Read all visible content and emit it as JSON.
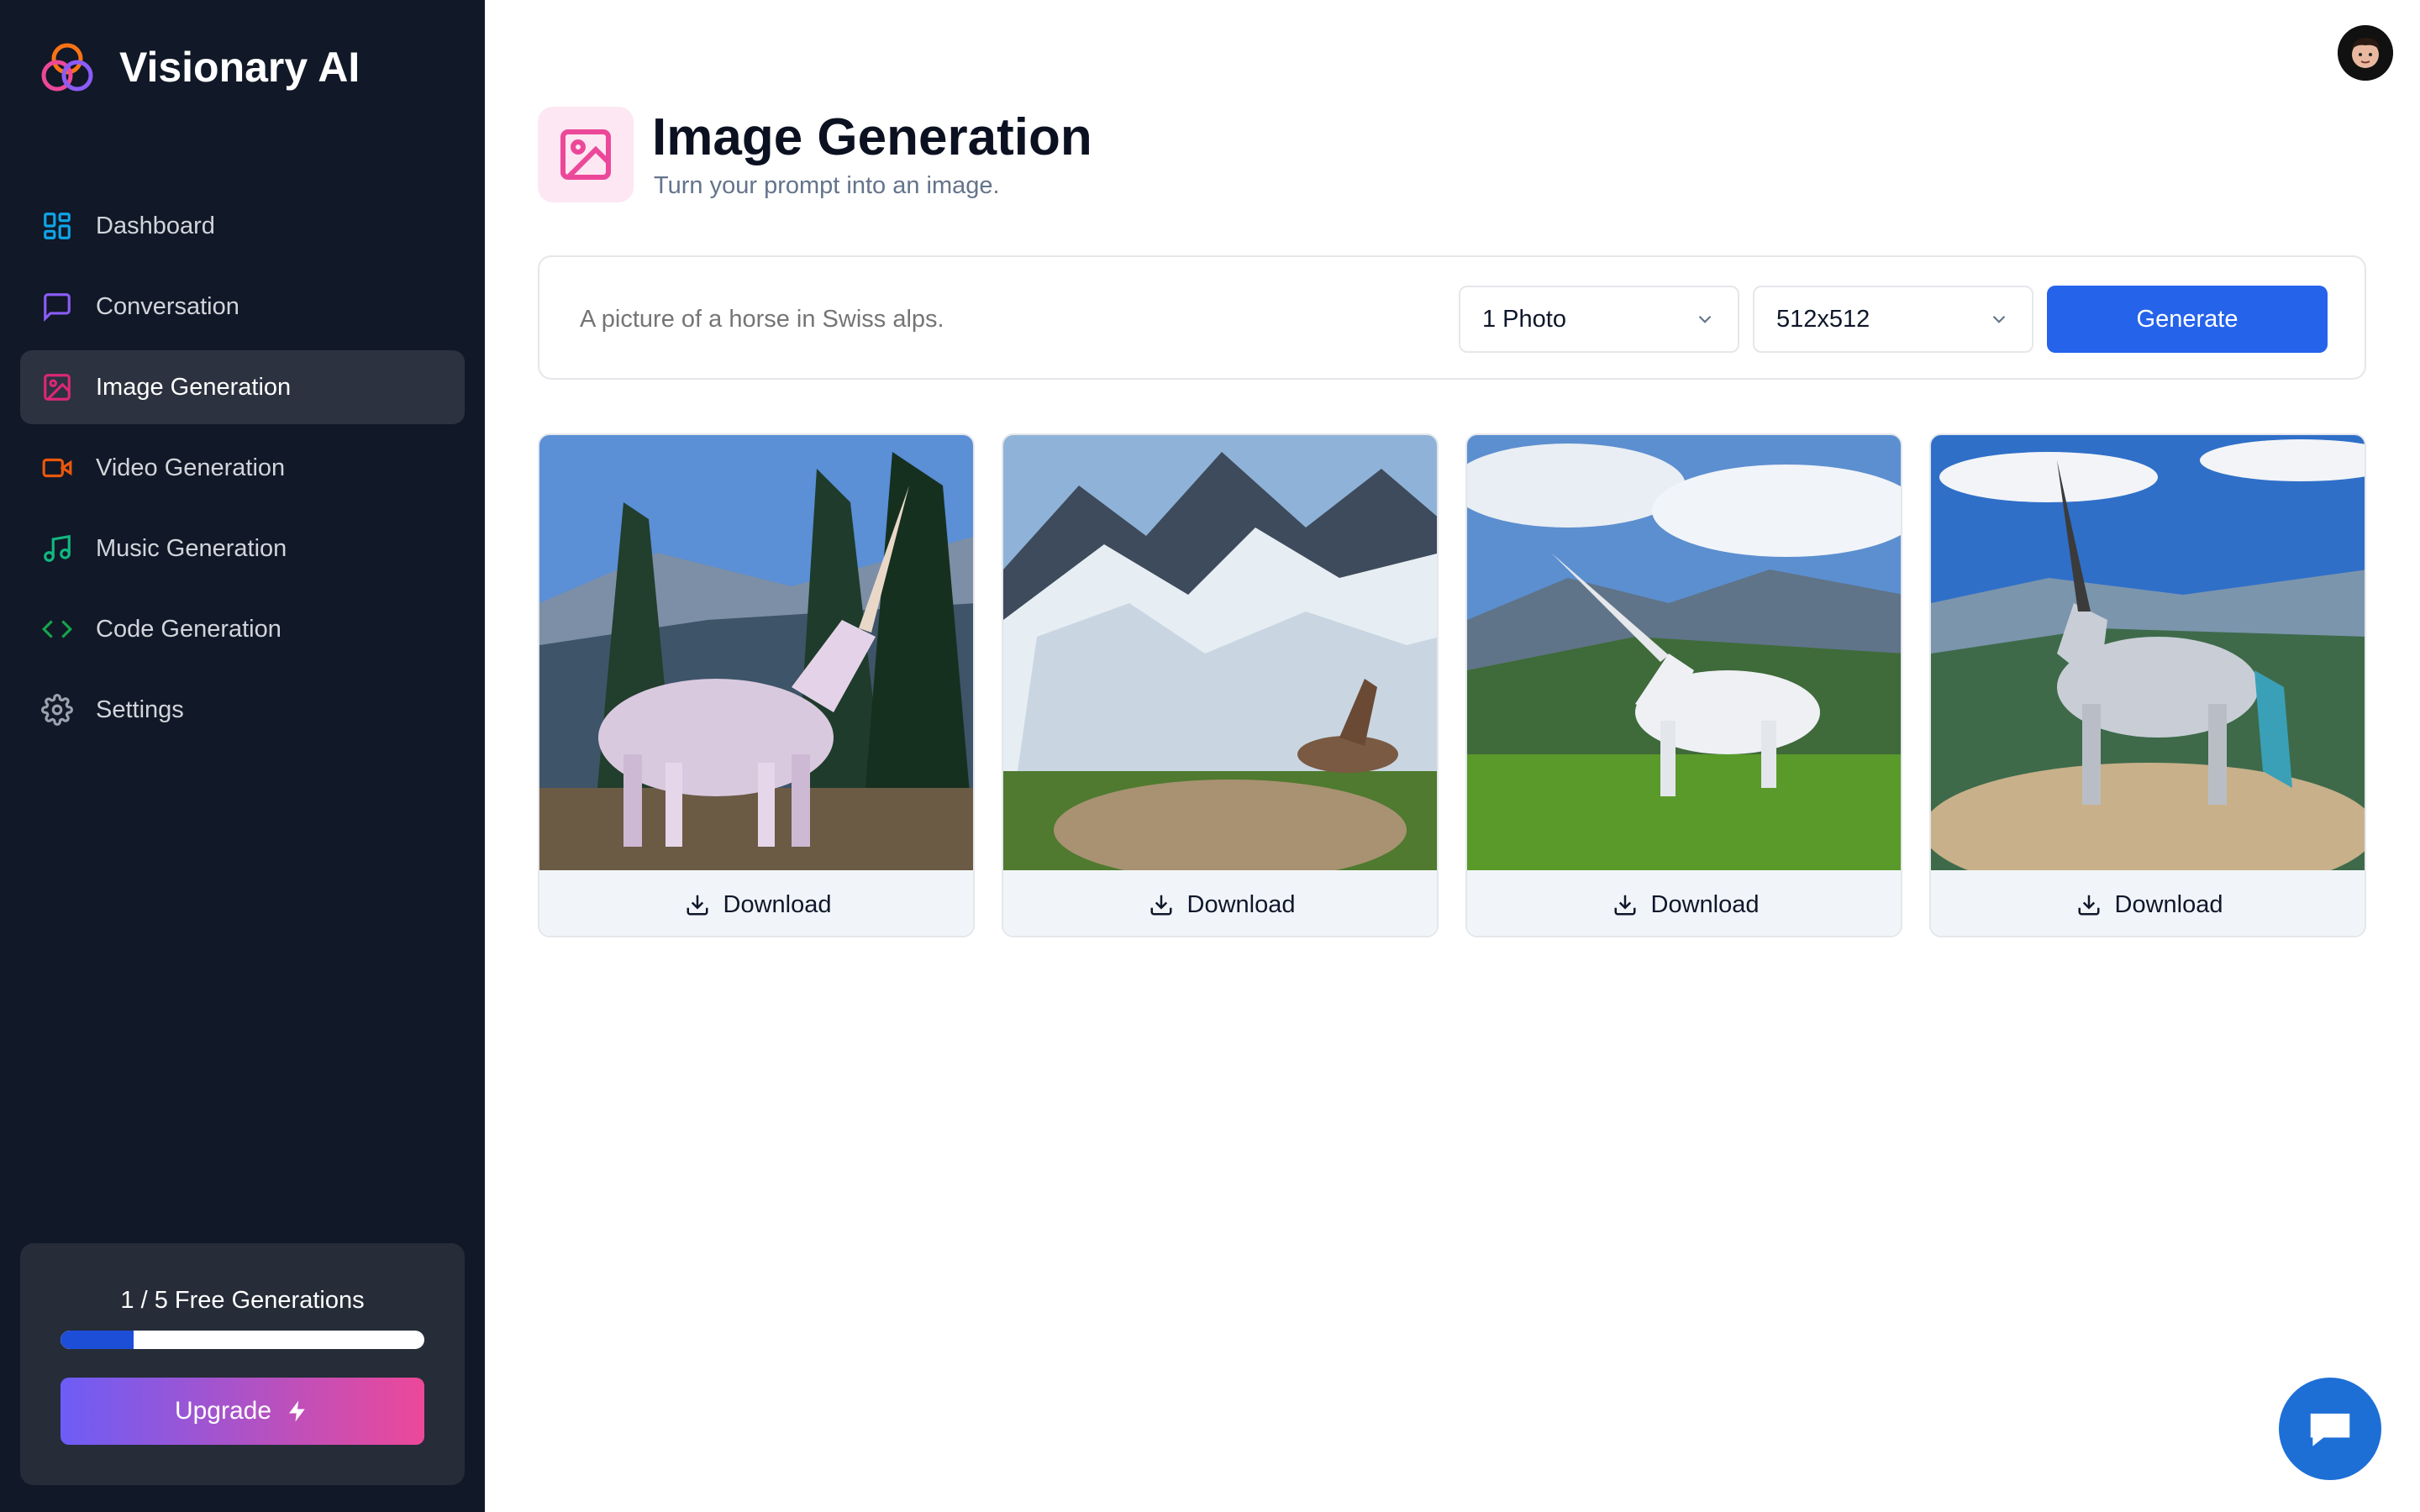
{
  "app": {
    "name": "Visionary AI"
  },
  "sidebar": {
    "items": [
      {
        "label": "Dashboard",
        "icon": "dashboard-icon",
        "color": "#0ea5e9",
        "active": false
      },
      {
        "label": "Conversation",
        "icon": "chat-icon",
        "color": "#8b5cf6",
        "active": false
      },
      {
        "label": "Image Generation",
        "icon": "image-icon",
        "color": "#db2777",
        "active": true
      },
      {
        "label": "Video Generation",
        "icon": "video-icon",
        "color": "#ea580c",
        "active": false
      },
      {
        "label": "Music Generation",
        "icon": "music-icon",
        "color": "#10b981",
        "active": false
      },
      {
        "label": "Code Generation",
        "icon": "code-icon",
        "color": "#16a34a",
        "active": false
      },
      {
        "label": "Settings",
        "icon": "gear-icon",
        "color": "#9ca3af",
        "active": false
      }
    ],
    "generations": {
      "text": "1 / 5 Free Generations",
      "used": 1,
      "total": 5
    },
    "upgrade_label": "Upgrade"
  },
  "header": {
    "title": "Image Generation",
    "subtitle": "Turn your prompt into an image."
  },
  "prompt": {
    "placeholder": "A picture of a horse in Swiss alps.",
    "amount_value": "1 Photo",
    "resolution_value": "512x512",
    "generate_label": "Generate"
  },
  "gallery": {
    "download_label": "Download",
    "images": [
      {
        "subject": "pink unicorn statue with pine trees"
      },
      {
        "subject": "snowy alpine peaks with horse on rock"
      },
      {
        "subject": "white unicorn in green alpine meadow"
      },
      {
        "subject": "white unicorn standing on rocky summit"
      }
    ]
  },
  "colors": {
    "sidebar_bg": "#111827",
    "active_item_bg": "#2c323f",
    "primary": "#2563eb",
    "accent_pink": "#ec4899"
  }
}
